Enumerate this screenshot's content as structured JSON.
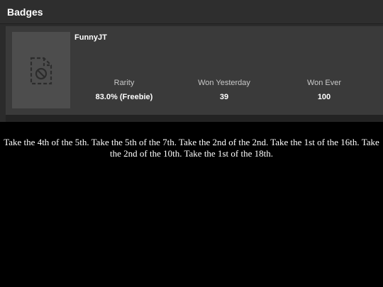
{
  "header": {
    "title": "Badges"
  },
  "badge": {
    "name": "FunnyJT",
    "image_icon": "no-image-file-icon",
    "stats": [
      {
        "label": "Rarity",
        "value": "83.0% (Freebie)"
      },
      {
        "label": "Won Yesterday",
        "value": "39"
      },
      {
        "label": "Won Ever",
        "value": "100"
      }
    ]
  },
  "caption": {
    "text": "Take the 4th of the 5th. Take the 5th of the 7th. Take the 2nd of the 2nd. Take the 1st of the 16th. Take the 2nd of the 10th. Take the 1st of the 18th."
  },
  "colors": {
    "page_background": "#000000",
    "panel_background": "#2b2b2b",
    "card_background": "#3a3a3a",
    "thumb_background": "#4d4d4d",
    "text_primary": "#ffffff",
    "text_secondary": "#c8c8c8"
  }
}
